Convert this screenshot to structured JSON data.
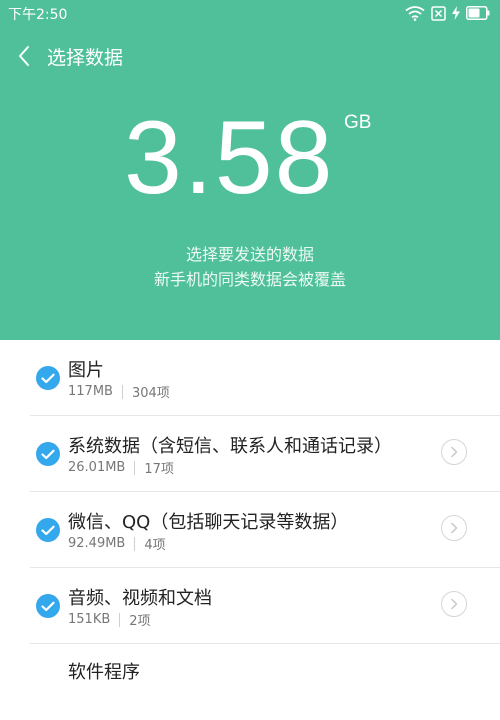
{
  "status_bar": {
    "time": "下午2:50",
    "icons": [
      "wifi-icon",
      "sim-blocked-icon",
      "charging-bolt-icon",
      "battery-icon"
    ]
  },
  "header": {
    "title": "选择数据",
    "back_icon": "chevron-left-icon"
  },
  "summary": {
    "total_size": "3.58",
    "unit": "GB",
    "line1": "选择要发送的数据",
    "line2": "新手机的同类数据会被覆盖"
  },
  "items": [
    {
      "title": "图片",
      "size": "117MB",
      "count": "304项",
      "checked": true,
      "has_detail": false
    },
    {
      "title": "系统数据（含短信、联系人和通话记录）",
      "size": "26.01MB",
      "count": "17项",
      "checked": true,
      "has_detail": true
    },
    {
      "title": "微信、QQ（包括聊天记录等数据）",
      "size": "92.49MB",
      "count": "4项",
      "checked": true,
      "has_detail": true
    },
    {
      "title": "音频、视频和文档",
      "size": "151KB",
      "count": "2项",
      "checked": true,
      "has_detail": true
    },
    {
      "title": "软件程序",
      "checked": true,
      "has_detail": false
    }
  ],
  "colors": {
    "accent_green": "#50c09a",
    "check_blue": "#34a8ec",
    "divider": "#e6e6e6"
  }
}
